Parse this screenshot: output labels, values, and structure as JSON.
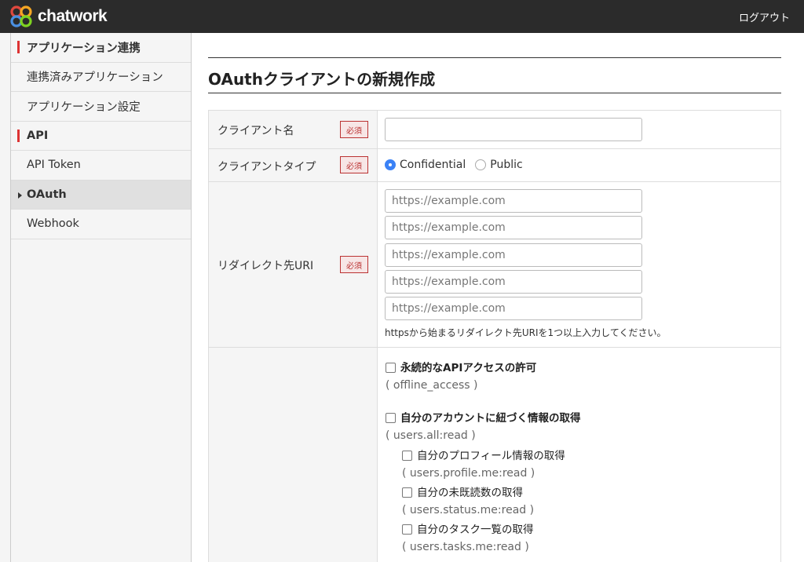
{
  "header": {
    "logo_text": "chatwork",
    "logout_label": "ログアウト"
  },
  "sidebar": {
    "items": [
      {
        "label": "アプリケーション連携",
        "type": "section"
      },
      {
        "label": "連携済みアプリケーション",
        "type": "item"
      },
      {
        "label": "アプリケーション設定",
        "type": "item"
      },
      {
        "label": "API",
        "type": "section"
      },
      {
        "label": "API Token",
        "type": "item"
      },
      {
        "label": "OAuth",
        "type": "item",
        "active": true
      },
      {
        "label": "Webhook",
        "type": "item"
      }
    ]
  },
  "main": {
    "title": "OAuthクライアントの新規作成",
    "required_label": "必須",
    "client_name": {
      "label": "クライアント名",
      "value": ""
    },
    "client_type": {
      "label": "クライアントタイプ",
      "options": [
        "Confidential",
        "Public"
      ],
      "selected": "Confidential"
    },
    "redirect_uri": {
      "label": "リダイレクト先URI",
      "placeholder": "https://example.com",
      "count": 5,
      "hint": "httpsから始まるリダイレクト先URIを1つ以上入力してください。"
    },
    "scopes": [
      {
        "title": "永続的なAPIアクセスの許可",
        "id": "( offline_access )",
        "checked": false,
        "level": 0
      },
      {
        "title": "自分のアカウントに紐づく情報の取得",
        "id": "( users.all:read )",
        "checked": false,
        "level": 0
      },
      {
        "title": "自分のプロフィール情報の取得",
        "id": "( users.profile.me:read )",
        "checked": false,
        "level": 1
      },
      {
        "title": "自分の未既読数の取得",
        "id": "( users.status.me:read )",
        "checked": false,
        "level": 1
      },
      {
        "title": "自分のタスク一覧の取得",
        "id": "( users.tasks.me:read )",
        "checked": false,
        "level": 1
      }
    ]
  },
  "colors": {
    "header_bg": "#2b2b2b",
    "accent_red": "#d33333",
    "radio_blue": "#3b82f6"
  }
}
